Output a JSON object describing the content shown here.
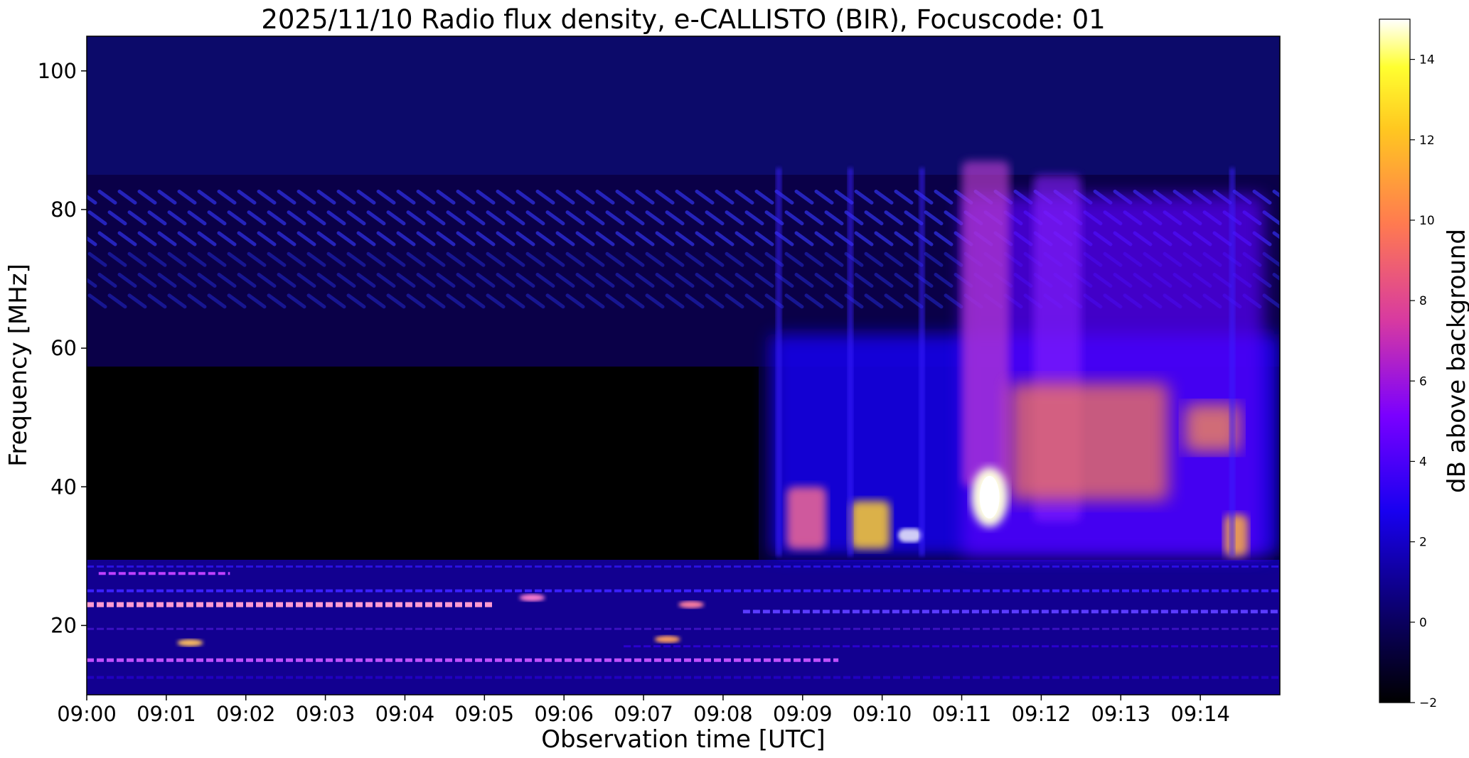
{
  "chart_data": [
    {
      "type": "heatmap",
      "title": "2025/11/10  Radio flux density, e-CALLISTO (BIR), Focuscode: 01",
      "xlabel": "Observation time [UTC]",
      "ylabel": "Frequency [MHz]",
      "x_ticks": [
        "09:00",
        "09:01",
        "09:02",
        "09:03",
        "09:04",
        "09:05",
        "09:06",
        "09:07",
        "09:08",
        "09:09",
        "09:10",
        "09:11",
        "09:12",
        "09:13",
        "09:14"
      ],
      "x_range": [
        "09:00",
        "09:15"
      ],
      "y_ticks": [
        20,
        40,
        60,
        80,
        100
      ],
      "ylim": [
        10,
        105
      ],
      "colormap": "gnuplot2",
      "colorbar": {
        "label": "dB above background",
        "range": [
          -2,
          15
        ],
        "ticks": [
          -2,
          0,
          2,
          4,
          6,
          8,
          10,
          12,
          14
        ]
      },
      "features": [
        {
          "desc": "diagonal drifting interference stripes",
          "time": [
            "09:00",
            "09:15"
          ],
          "freq_mhz": [
            62,
            82
          ]
        },
        {
          "desc": "quiet region",
          "time": [
            "09:00",
            "09:08"
          ],
          "freq_mhz": [
            30,
            57
          ]
        },
        {
          "desc": "terrestrial interference bands",
          "time": [
            "09:00",
            "09:15"
          ],
          "freq_mhz": [
            10,
            30
          ]
        },
        {
          "desc": "solar radio burst",
          "time": [
            "09:08",
            "09:15"
          ],
          "freq_mhz": [
            30,
            87
          ]
        },
        {
          "desc": "peak emission",
          "time": "09:11",
          "freq_mhz": [
            33,
            44
          ],
          "value_db": 15
        }
      ]
    }
  ]
}
